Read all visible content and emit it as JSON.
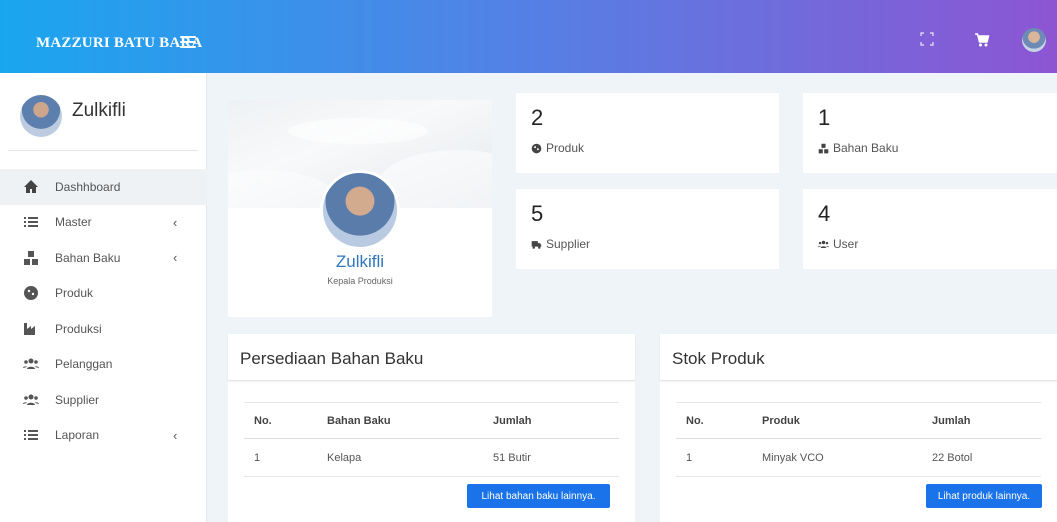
{
  "header": {
    "brand": "MAZZURI BATU BARA"
  },
  "sidebar": {
    "user_name": "Zulkifli",
    "items": [
      {
        "label": "Dashhboard",
        "icon": "home-icon",
        "active": true
      },
      {
        "label": "Master",
        "icon": "list-icon",
        "chevron": "‹"
      },
      {
        "label": "Bahan Baku",
        "icon": "boxes-icon",
        "chevron": "‹"
      },
      {
        "label": "Produk",
        "icon": "cookie-icon"
      },
      {
        "label": "Produksi",
        "icon": "industry-icon"
      },
      {
        "label": "Pelanggan",
        "icon": "users-icon"
      },
      {
        "label": "Supplier",
        "icon": "users-icon"
      },
      {
        "label": "Laporan",
        "icon": "list-icon",
        "chevron": "‹"
      }
    ]
  },
  "profile": {
    "name": "Zulkifli",
    "role": "Kepala Produksi"
  },
  "stats": [
    {
      "value": "2",
      "label": "Produk",
      "icon": "cookie-icon"
    },
    {
      "value": "1",
      "label": "Bahan Baku",
      "icon": "boxes-icon"
    },
    {
      "value": "5",
      "label": "Supplier",
      "icon": "truck-icon"
    },
    {
      "value": "4",
      "label": "User",
      "icon": "users-icon"
    }
  ],
  "bahan_baku": {
    "title": "Persediaan Bahan Baku",
    "columns": [
      "No.",
      "Bahan Baku",
      "Jumlah"
    ],
    "rows": [
      [
        "1",
        "Kelapa",
        "51 Butir"
      ]
    ],
    "button": "Lihat bahan baku lainnya."
  },
  "stok_produk": {
    "title": "Stok Produk",
    "columns": [
      "No.",
      "Produk",
      "Jumlah"
    ],
    "rows": [
      [
        "1",
        "Minyak VCO",
        "22 Botol"
      ]
    ],
    "button": "Lihat produk lainnya."
  },
  "colors": {
    "accent": "#1a73e8",
    "gradient_start": "#1aa6ef",
    "gradient_end": "#8d55d3",
    "profile_name": "#2e77bd"
  }
}
